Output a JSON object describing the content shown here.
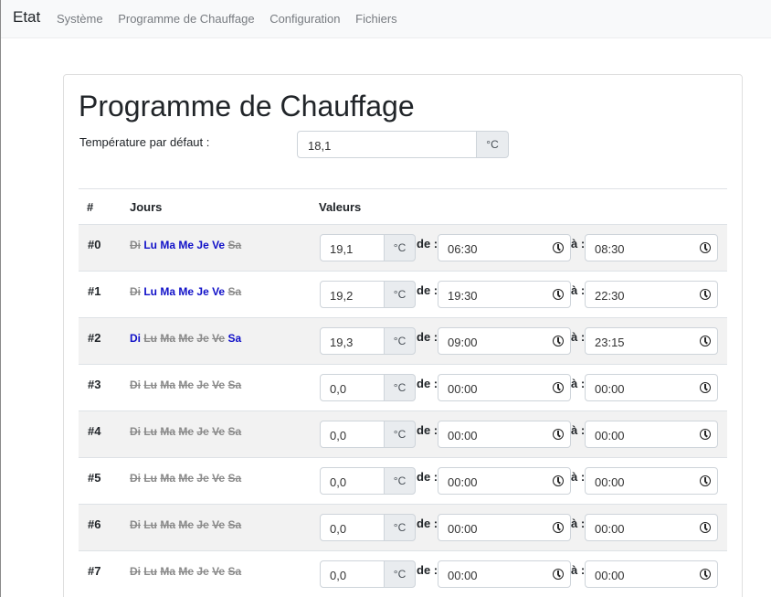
{
  "navbar": {
    "brand": "Etat",
    "links": [
      "Système",
      "Programme de Chauffage",
      "Configuration",
      "Fichiers"
    ]
  },
  "page": {
    "title": "Programme de Chauffage",
    "default_temp_label": "Température par défaut :",
    "default_temp_value": "18,1",
    "unit": "°C"
  },
  "table": {
    "headers": [
      "#",
      "Jours",
      "Valeurs"
    ],
    "from_label": "de :",
    "to_label": "à :",
    "day_names": [
      "Di",
      "Lu",
      "Ma",
      "Me",
      "Je",
      "Ve",
      "Sa"
    ],
    "rows": [
      {
        "id": "#0",
        "days_on": [
          false,
          true,
          true,
          true,
          true,
          true,
          false
        ],
        "temp": "19,1",
        "from": "06:30",
        "to": "08:30"
      },
      {
        "id": "#1",
        "days_on": [
          false,
          true,
          true,
          true,
          true,
          true,
          false
        ],
        "temp": "19,2",
        "from": "19:30",
        "to": "22:30"
      },
      {
        "id": "#2",
        "days_on": [
          true,
          false,
          false,
          false,
          false,
          false,
          true
        ],
        "temp": "19,3",
        "from": "09:00",
        "to": "23:15"
      },
      {
        "id": "#3",
        "days_on": [
          false,
          false,
          false,
          false,
          false,
          false,
          false
        ],
        "temp": "0,0",
        "from": "00:00",
        "to": "00:00"
      },
      {
        "id": "#4",
        "days_on": [
          false,
          false,
          false,
          false,
          false,
          false,
          false
        ],
        "temp": "0,0",
        "from": "00:00",
        "to": "00:00"
      },
      {
        "id": "#5",
        "days_on": [
          false,
          false,
          false,
          false,
          false,
          false,
          false
        ],
        "temp": "0,0",
        "from": "00:00",
        "to": "00:00"
      },
      {
        "id": "#6",
        "days_on": [
          false,
          false,
          false,
          false,
          false,
          false,
          false
        ],
        "temp": "0,0",
        "from": "00:00",
        "to": "00:00"
      },
      {
        "id": "#7",
        "days_on": [
          false,
          false,
          false,
          false,
          false,
          false,
          false
        ],
        "temp": "0,0",
        "from": "00:00",
        "to": "00:00"
      }
    ]
  },
  "colors": {
    "day_on": "#1010c8",
    "day_off": "#8a8a8a",
    "stripe": "#f2f2f2"
  }
}
